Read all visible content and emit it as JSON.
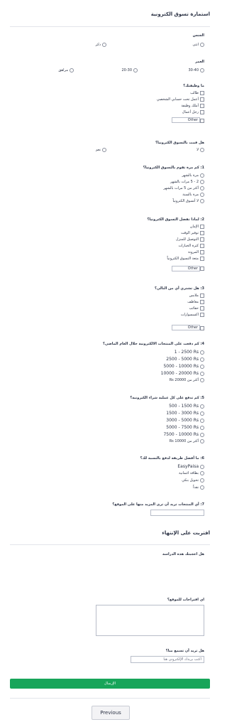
{
  "form_title": "استمارة تسوق الكترونية",
  "gender": {
    "question": "الجنس",
    "options": [
      "انثى",
      "ذكر"
    ]
  },
  "age": {
    "question": "العمر",
    "options": [
      "30-40",
      "20-30",
      "مراهق"
    ]
  },
  "job": {
    "question": "ما وظيفتك؟",
    "options": [
      "طالب",
      "أعمل تحت حسابي الشخصي",
      "أملك وظيفة",
      "رجل أعمال"
    ],
    "other_label": "Other"
  },
  "shopped": {
    "question": "هل قمت بالتسوق الكترونيا؟",
    "options": [
      "لا",
      "نعم"
    ]
  },
  "q1": {
    "question": "1: كم مرة تقوم بالتسوق الكترونيا؟",
    "options": [
      "مرة بالشهر",
      "2 - 5 مرات بالشهر",
      "أكثر من 5 مرات بالشهر",
      "مرة بالسنة",
      "لا أتسوق الكترونياً"
    ]
  },
  "q2": {
    "question": "2: لماذا تفضل التسوق الكترونيا؟",
    "options": [
      "الإمان",
      "توفير الوقت",
      "التوصيل للمنزل",
      "كثرة الخيارات",
      "المرونة",
      "متعة التسوق الكترونياً"
    ],
    "other_label": "Other"
  },
  "q3": {
    "question": "3: هل تشتري أي من التالي؟",
    "options": [
      "ملابس",
      "معاطف",
      "حقائب",
      "اكسسوارات"
    ],
    "other_label": "Other"
  },
  "q4": {
    "question": "4: كم دفعت على المنتجات الالكترونية خلال العام الماضي؟",
    "options": [
      "1 - 2500 Rs",
      "2500 - 5000 Rs",
      "5000 - 10000 Rs",
      "10000 - 20000 Rs",
      "أكثر من 20000 Rs"
    ]
  },
  "q5": {
    "question": "5: كم تدفع على كل عملية شراء الكترونية؟",
    "options": [
      "500 - 1500 Rs",
      "1500 - 3000 Rs",
      "3000 - 5000 Rs",
      "5000 - 7500 Rs",
      "7500 - 10000 Rs",
      "أكثر من 10000 Rs"
    ]
  },
  "q6": {
    "question": "6: ما أفضل طريقة لدفع بالنسبة لك؟",
    "options": [
      "EasyPaisa",
      "بطاقة ائتمانية",
      "تحويل بنكي",
      "نقداً"
    ]
  },
  "q7": {
    "question": "7: أي المنتجات تريد أن ترى المزيد منها على الموقع؟"
  },
  "section2_title": "اقتربت على الإنتهاء",
  "liked": {
    "question": "هل اعجبتك هذه الدراسة"
  },
  "suggestions": {
    "question": "اي اقتراحات للموقع؟"
  },
  "hear": {
    "question": "هل تريد أن تسمع منا؟",
    "placeholder": "اكتب بريدك الإلكتروني هنا"
  },
  "submit_label": "الإرسال",
  "previous_label": "Previous"
}
